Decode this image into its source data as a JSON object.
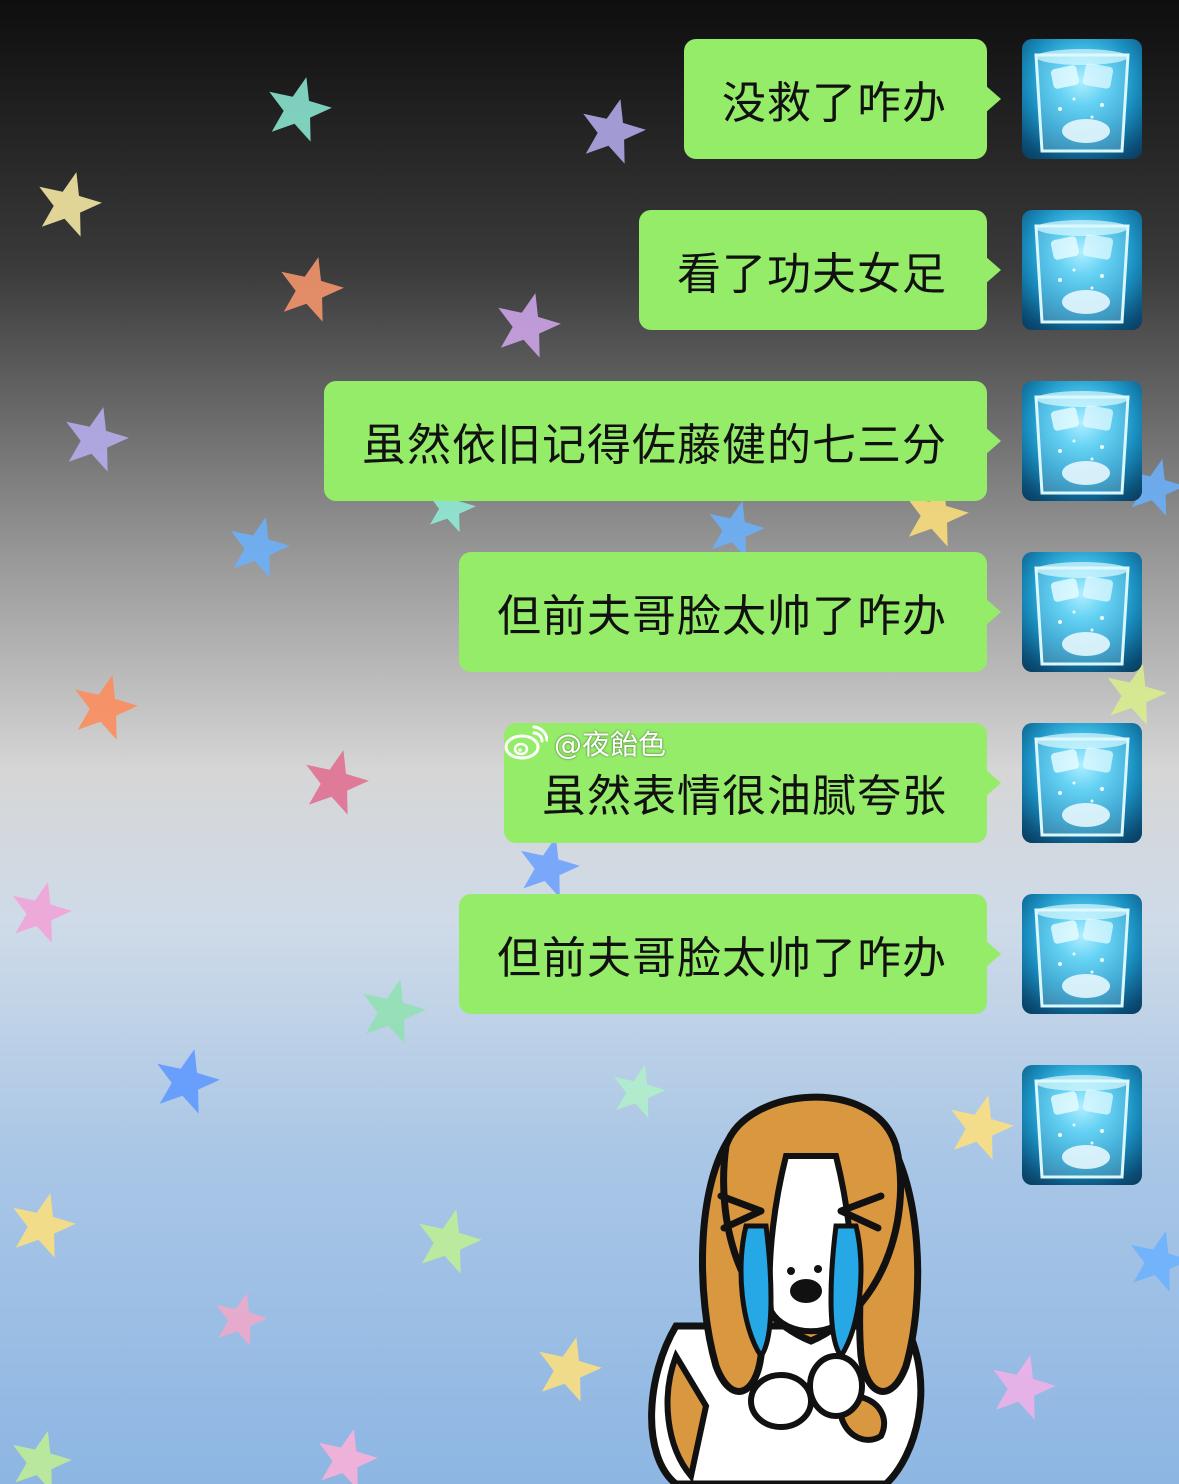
{
  "chat": {
    "messages": [
      {
        "sender": "self",
        "text": "没救了咋办"
      },
      {
        "sender": "self",
        "text": "看了功夫女足"
      },
      {
        "sender": "self",
        "text": "虽然依旧记得佐藤健的七三分"
      },
      {
        "sender": "self",
        "text": "但前夫哥脸太帅了咋办"
      },
      {
        "sender": "self",
        "text": "虽然表情很油腻夸张"
      },
      {
        "sender": "self",
        "text": "但前夫哥脸太帅了咋办"
      },
      {
        "sender": "self",
        "type": "sticker",
        "sticker": "crying-puppy-sticker"
      }
    ],
    "bubble_color": "#95ec69",
    "avatar": "ice-water-glass-avatar"
  },
  "watermark": {
    "text": "@夜飴色",
    "icon": "weibo-icon"
  },
  "background": {
    "pattern": "pastel-stars",
    "gradient": [
      "#0e0e0e",
      "#9a9a9a",
      "#d6d6d6",
      "#8db6e3"
    ]
  }
}
